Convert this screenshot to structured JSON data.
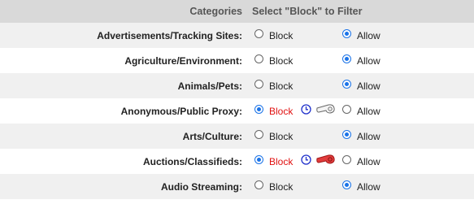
{
  "header": {
    "categories_label": "Categories",
    "select_label": "Select \"Block\" to Filter"
  },
  "colors": {
    "header_bg": "#d9d9d9",
    "row_shaded": "#f0f0f0",
    "radio_checked": "#1a73e8",
    "blocked_text": "#e01010"
  },
  "options": {
    "block": "Block",
    "allow": "Allow"
  },
  "rows": [
    {
      "category": "Advertisements/Tracking Sites:",
      "selected": "allow"
    },
    {
      "category": "Agriculture/Environment:",
      "selected": "allow"
    },
    {
      "category": "Animals/Pets:",
      "selected": "allow"
    },
    {
      "category": "Anonymous/Public Proxy:",
      "selected": "block",
      "icons": [
        "clock-icon",
        "whistle-icon-gray"
      ]
    },
    {
      "category": "Arts/Culture:",
      "selected": "allow"
    },
    {
      "category": "Auctions/Classifieds:",
      "selected": "block",
      "icons": [
        "clock-icon",
        "whistle-icon-red"
      ]
    },
    {
      "category": "Audio Streaming:",
      "selected": "allow"
    }
  ]
}
